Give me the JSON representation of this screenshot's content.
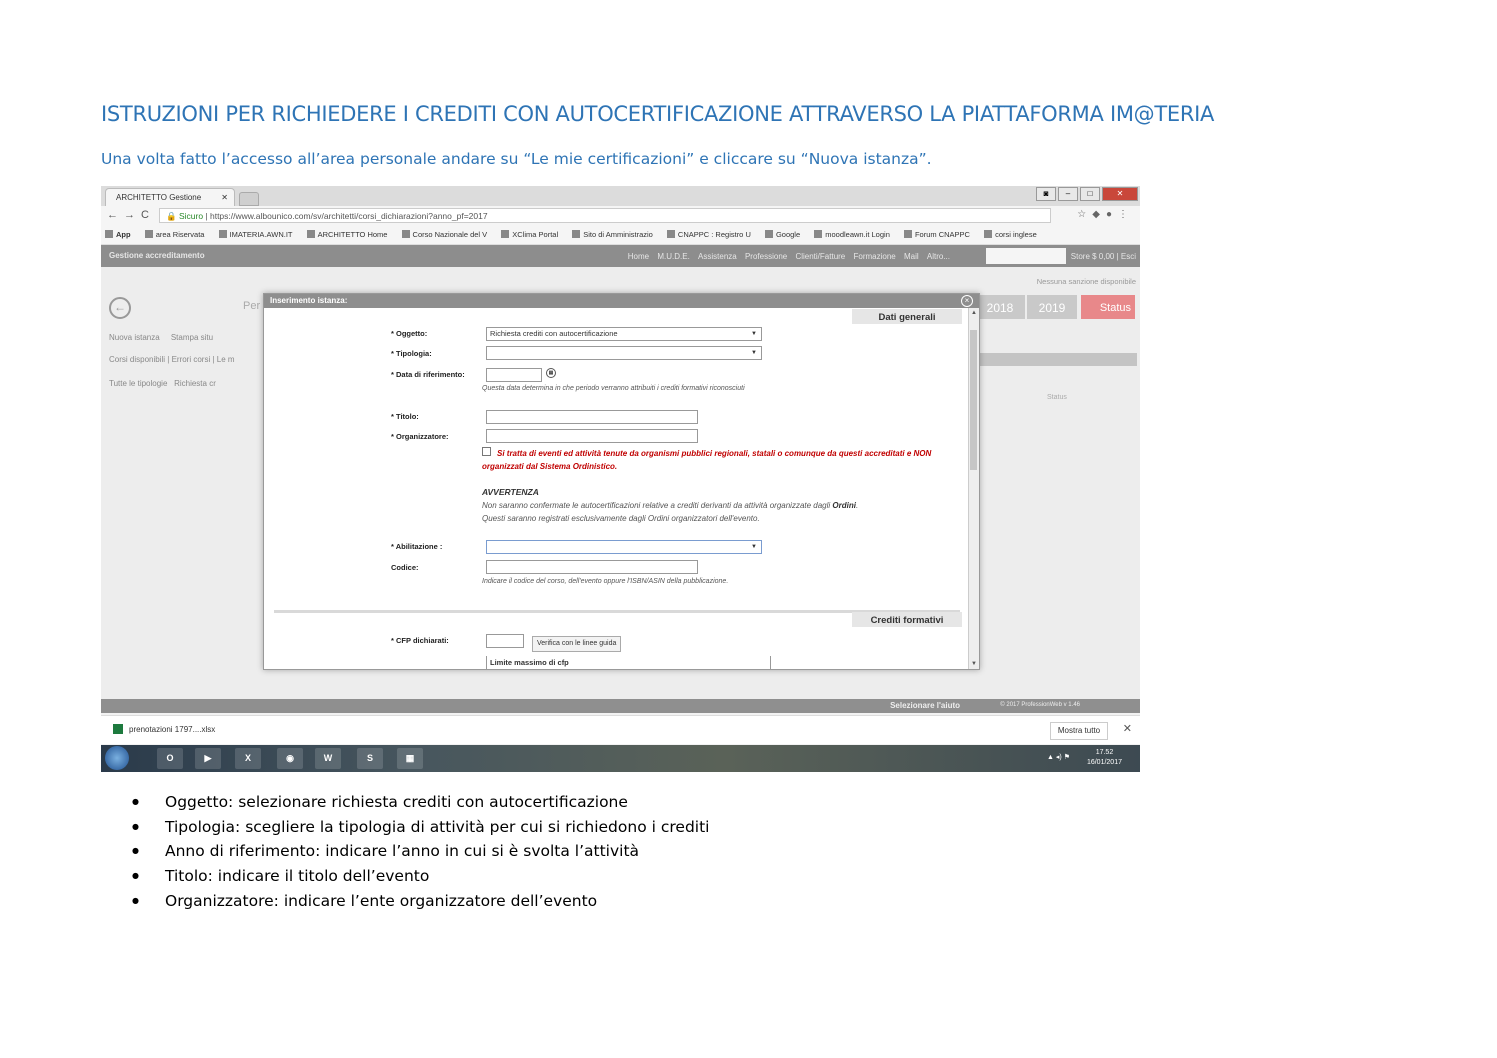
{
  "document": {
    "title": "ISTRUZIONI PER RICHIEDERE I CREDITI CON AUTOCERTIFICAZIONE ATTRAVERSO LA PIATTAFORMA IM@TERIA",
    "intro": "Una volta fatto l’accesso all’area personale andare su “Le mie certificazioni” e cliccare su “Nuova istanza”.",
    "bullets": [
      "Oggetto: selezionare richiesta crediti con autocertificazione",
      "Tipologia: scegliere la tipologia di attività per cui si richiedono i crediti",
      "Anno di riferimento: indicare l’anno in cui si è svolta l’attività",
      "Titolo: indicare il titolo dell’evento",
      "Organizzatore: indicare l’ente organizzatore dell’evento"
    ]
  },
  "browser": {
    "tab_title": "ARCHITETTO Gestione",
    "url_secure": "Sicuro",
    "url": "https://www.albounico.com/sv/architetti/corsi_dichiarazioni?anno_pf=2017",
    "bookmarks": [
      "App",
      "area Riservata",
      "IMATERIA.AWN.IT",
      "ARCHITETTO Home",
      "Corso Nazionale del V",
      "XClima Portal",
      "Sito di Amministrazio",
      "CNAPPC : Registro U",
      "Google",
      "moodleawn.it Login",
      "Forum CNAPPC",
      "corsi inglese"
    ]
  },
  "app": {
    "brand": "Gestione accreditamento",
    "menu": [
      "Home",
      "M.U.D.E.",
      "Assistenza",
      "Professione",
      "Clienti/Fatture",
      "Formazione",
      "Mail",
      "Altro..."
    ],
    "store": "Store $ 0,00 | Esci",
    "notice": "Nessuna sanzione disponibile",
    "page_partial": "Per",
    "toolbar": [
      "Nuova istanza",
      "Stampa situ"
    ],
    "filters": [
      "Corsi disponibili",
      "Errori corsi",
      "Le m"
    ],
    "tipologie": [
      "Tutte le tipologie",
      "Richiesta cr"
    ],
    "years": [
      "2018",
      "2019"
    ],
    "status_label": "Status",
    "status_col": "Status",
    "help": "Selezionare l'aiuto",
    "version": "© 2017 ProfessionWeb v 1.46"
  },
  "modal": {
    "title": "Inserimento istanza:",
    "section_general": "Dati generali",
    "section_credits": "Crediti formativi",
    "oggetto_label": "* Oggetto:",
    "oggetto_value": "Richiesta crediti con autocertificazione",
    "tipologia_label": "* Tipologia:",
    "data_label": "* Data di riferimento:",
    "data_hint": "Questa data determina in che periodo verranno attribuiti i crediti formativi riconosciuti",
    "titolo_label": "* Titolo:",
    "organizzatore_label": "* Organizzatore:",
    "red_note": "Si tratta di eventi ed attività tenute da organismi pubblici regionali, statali o comunque da questi accreditati e NON organizzati dal Sistema Ordinistico.",
    "warning_title": "AVVERTENZA",
    "warning_text_1": "Non saranno confermate le autocertificazioni relative a crediti derivanti da attività organizzate dagli",
    "warning_bold": "Ordini",
    "warning_text_2": "Questi saranno registrati esclusivamente dagli Ordini organizzatori dell'evento.",
    "abilitazione_label": "* Abilitazione :",
    "codice_label": "Codice:",
    "codice_hint": "Indicare il codice del corso, dell'evento oppure l'ISBN/ASIN della pubblicazione.",
    "cfp_label": "* CFP dichiarati:",
    "verify_button": "Verifica con le linee guida",
    "limit_label": "Limite massimo di cfp"
  },
  "downloads": {
    "file": "prenotazioni 1797....xlsx",
    "show_all": "Mostra tutto"
  },
  "taskbar": {
    "time": "17.52",
    "date": "16/01/2017",
    "apps": [
      "O",
      "▶",
      "X",
      "◉",
      "W",
      "S",
      "▦"
    ]
  }
}
